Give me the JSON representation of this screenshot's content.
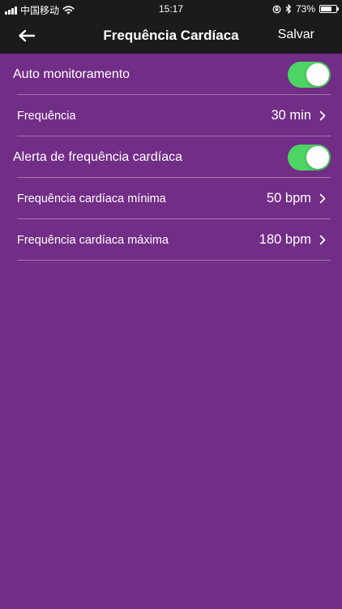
{
  "status_bar": {
    "carrier": "中国移动",
    "time": "15:17",
    "battery": "73%",
    "battery_level": 0.73
  },
  "nav": {
    "title": "Frequência Cardíaca",
    "save_label": "Salvar",
    "back_icon": "arrow-left-icon"
  },
  "settings": {
    "auto_monitoring": {
      "label": "Auto monitoramento",
      "enabled": true
    },
    "frequency": {
      "label": "Frequência",
      "value": "30 min"
    },
    "heart_rate_alert": {
      "label": "Alerta de frequência cardíaca",
      "enabled": true
    },
    "min_heart_rate": {
      "label": "Frequência cardíaca mínima",
      "value": "50 bpm"
    },
    "max_heart_rate": {
      "label": "Frequência cardíaca máxima",
      "value": "180 bpm"
    }
  },
  "colors": {
    "background": "#722d87",
    "bar": "#1b1b1b",
    "toggle_on": "#4cd464"
  }
}
